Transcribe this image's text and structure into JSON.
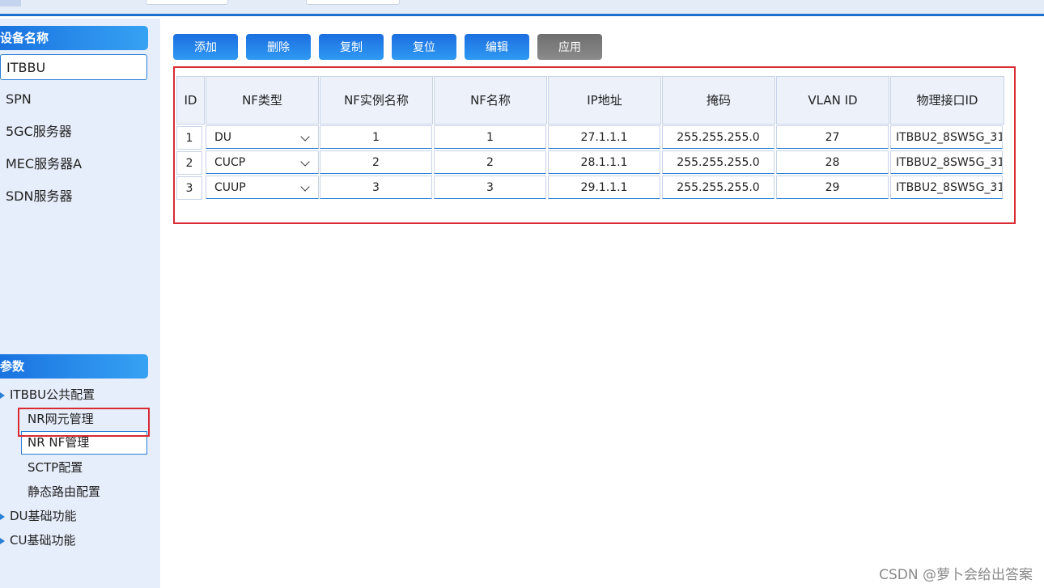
{
  "sidebar": {
    "device_header": "设备名称",
    "devices": [
      "ITBBU",
      "SPN",
      "5GC服务器",
      "MEC服务器A",
      "SDN服务器"
    ],
    "selected_device": "ITBBU",
    "param_header": "参数",
    "tree": {
      "public_config": "ITBBU公共配置",
      "nr_netelem": "NR网元管理",
      "nr_nf": "NR NF管理",
      "sctp": "SCTP配置",
      "static_route": "静态路由配置",
      "du_basic": "DU基础功能",
      "cu_basic": "CU基础功能"
    }
  },
  "toolbar": {
    "add": "添加",
    "delete": "删除",
    "copy": "复制",
    "reset": "复位",
    "edit": "编辑",
    "apply": "应用"
  },
  "table": {
    "headers": [
      "ID",
      "NF类型",
      "NF实例名称",
      "NF名称",
      "IP地址",
      "掩码",
      "VLAN ID",
      "物理接口ID"
    ],
    "rows": [
      {
        "id": "1",
        "nf_type": "DU",
        "instance": "1",
        "name": "1",
        "ip": "27.1.1.1",
        "mask": "255.255.255.0",
        "vlan": "27",
        "port": "ITBBU2_8SW5G_31"
      },
      {
        "id": "2",
        "nf_type": "CUCP",
        "instance": "2",
        "name": "2",
        "ip": "28.1.1.1",
        "mask": "255.255.255.0",
        "vlan": "28",
        "port": "ITBBU2_8SW5G_31"
      },
      {
        "id": "3",
        "nf_type": "CUUP",
        "instance": "3",
        "name": "3",
        "ip": "29.1.1.1",
        "mask": "255.255.255.0",
        "vlan": "29",
        "port": "ITBBU2_8SW5G_31"
      }
    ]
  },
  "watermark": "CSDN @萝卜会给出答案",
  "colors": {
    "accent_blue": "#1c6fd0",
    "highlight_red": "#d92b32",
    "sidebar_bg": "#e7eefb",
    "apply_gray": "#777777"
  }
}
